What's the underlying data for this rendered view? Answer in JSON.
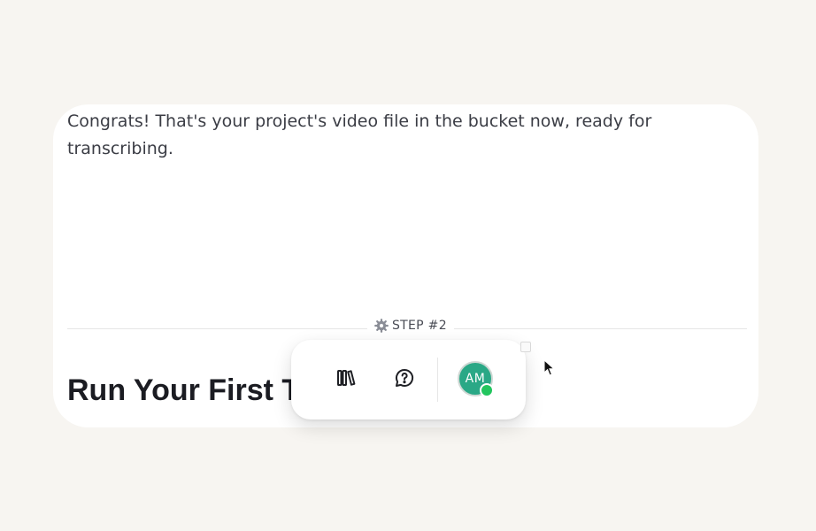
{
  "content": {
    "intro": "Congrats! That's your project's video file in the bucket now, ready for transcribing.",
    "step_label": "STEP #2",
    "heading": "Run Your First T"
  },
  "toolbar": {
    "icons": {
      "library": "library-icon",
      "help": "help-chat-icon"
    },
    "avatar_initials": "AM",
    "avatar_color": "#2aa886",
    "status_color": "#22c55e"
  }
}
